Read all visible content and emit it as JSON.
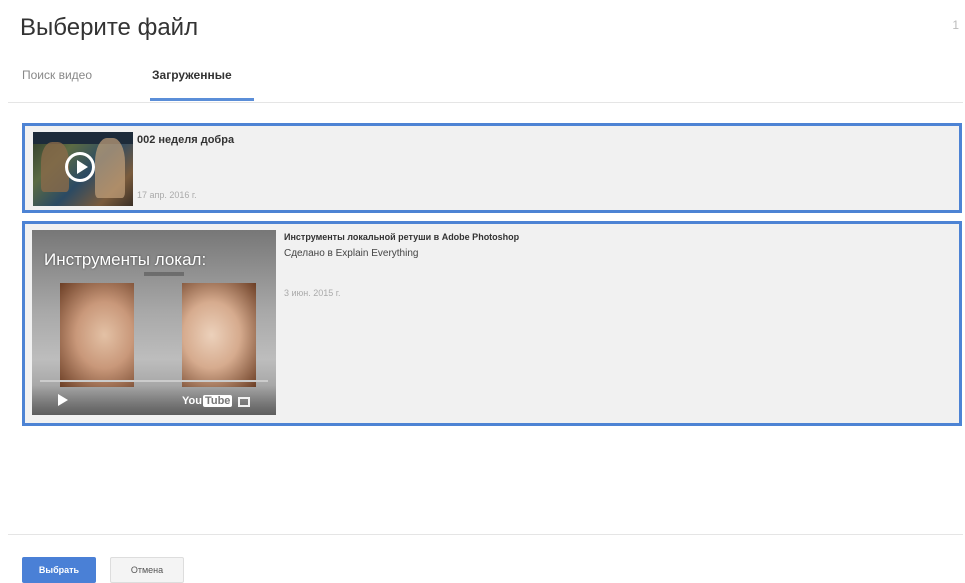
{
  "dialog": {
    "title": "Выберите файл",
    "close_label": "1"
  },
  "tabs": [
    {
      "label": "Поиск видео",
      "active": false
    },
    {
      "label": "Загруженные",
      "active": true
    }
  ],
  "videos": [
    {
      "title": "002 неделя добра",
      "subtitle": "",
      "date": "17 апр. 2016 г.",
      "selected": true
    },
    {
      "title": "Инструменты локальной ретуши в Adobe Photoshop",
      "subtitle": "Сделано в Explain Everything",
      "date": "3 июн. 2015 г.",
      "thumbnail_text": "Инструменты локал:",
      "player_logo": "YouTube",
      "selected": true
    }
  ],
  "buttons": {
    "select_label": "Выбрать",
    "cancel_label": "Отмена"
  },
  "colors": {
    "accent": "#4a80d6",
    "selection_border": "#4d83d4",
    "item_background": "#f1f1f1"
  }
}
